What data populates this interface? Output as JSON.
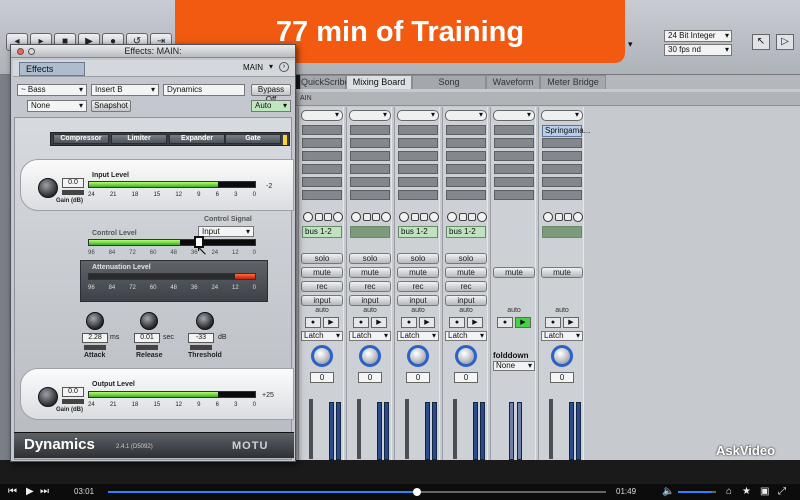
{
  "banner": {
    "text": "77 min of Training"
  },
  "window": {
    "title": "Effects: MAIN:"
  },
  "top_right": {
    "bit_depth": "24 Bit Integer",
    "frame_rate": "30 fps nd"
  },
  "tabs": [
    {
      "label": "QuickScribe"
    },
    {
      "label": "Mixing Board",
      "active": true
    },
    {
      "label": "Song"
    },
    {
      "label": "Waveform"
    },
    {
      "label": "Meter Bridge"
    }
  ],
  "ruler": {
    "label": "AIN"
  },
  "effects_panel": {
    "tab_label": "Effects",
    "main_selector": "MAIN",
    "track_select": "~ Bass",
    "insert_select": "Insert B",
    "plugin_name": "Dynamics",
    "bypass_label": "Bypass Off",
    "preset_select": "None",
    "snapshot_label": "Snapshot",
    "auto_select": "Auto"
  },
  "dynamics": {
    "modes": [
      "Compressor",
      "Limiter",
      "Expander",
      "Gate"
    ],
    "selected_mode": "Gate",
    "input_level_label": "Input Level",
    "input_gain_value": "0.0",
    "input_gain_label": "Gain (dB)",
    "input_level": 0.78,
    "input_peak_label": "-2",
    "scale_input": [
      "24",
      "21",
      "18",
      "15",
      "12",
      "9",
      "6",
      "3",
      "0"
    ],
    "control_signal_label": "Control Signal",
    "control_signal_value": "Input",
    "control_level_label": "Control Level",
    "control_level": 0.55,
    "scale_db": [
      "96",
      "84",
      "72",
      "60",
      "48",
      "36",
      "24",
      "12",
      "0"
    ],
    "attenuation_label": "Attenuation Level",
    "attenuation_level": 0.12,
    "attack_value": "2.28",
    "attack_unit": "ms",
    "attack_label": "Attack",
    "release_value": "0.01",
    "release_unit": "sec",
    "release_label": "Release",
    "threshold_value": "-33",
    "threshold_unit": "dB",
    "threshold_label": "Threshold",
    "output_level_label": "Output Level",
    "output_gain_value": "0.0",
    "output_gain_label": "Gain (dB)",
    "output_level": 0.78,
    "output_peak_label": "+25",
    "plugin_title": "Dynamics",
    "version": "2.4.1 (D5092)",
    "brand": "MOTU"
  },
  "mixer": {
    "strips": [
      {
        "bus": "bus 1-2",
        "buttons": [
          "solo",
          "mute",
          "rec",
          "input"
        ],
        "auto": "auto",
        "latch": "Latch",
        "value": "0"
      },
      {
        "bus": "",
        "buttons": [
          "solo",
          "mute",
          "rec",
          "input"
        ],
        "auto": "auto",
        "latch": "Latch",
        "value": "0"
      },
      {
        "bus": "bus 1-2",
        "buttons": [
          "solo",
          "mute",
          "rec",
          "input"
        ],
        "auto": "auto",
        "latch": "Latch",
        "value": "0"
      },
      {
        "bus": "bus 1-2",
        "buttons": [
          "solo",
          "mute",
          "rec",
          "input"
        ],
        "auto": "auto",
        "latch": "Latch",
        "value": "0"
      },
      {
        "bus": "",
        "buttons": [
          "mute"
        ],
        "auto": "auto",
        "foldown": "folddown",
        "foldown_value": "None"
      },
      {
        "bus": "",
        "insert": "Springama...",
        "buttons": [
          "mute"
        ],
        "auto": "auto",
        "latch": "Latch",
        "value": "0"
      }
    ]
  },
  "watermark": "AskVideo",
  "player": {
    "elapsed": "03:01",
    "remaining": "01:49",
    "progress": 0.62,
    "volume": 0.9
  }
}
